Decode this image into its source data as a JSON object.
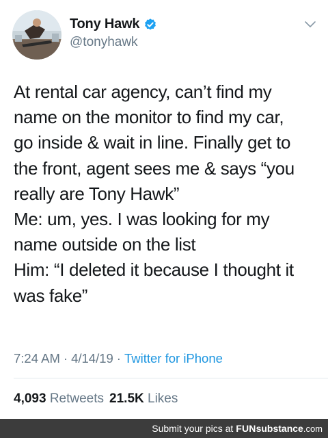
{
  "tweet": {
    "display_name": "Tony Hawk",
    "handle": "@tonyhawk",
    "text_lines": [
      "At rental car agency, can’t find my",
      "name on the monitor to find my car,",
      "go inside & wait in line. Finally get to",
      "the front, agent sees me & says “you",
      "really are Tony Hawk”",
      "Me: um, yes. I was looking for my",
      "name outside on the list",
      "Him: “I deleted it because I thought it",
      "was fake”"
    ],
    "time": "7:24 AM",
    "date": "4/14/19",
    "source": "Twitter for iPhone",
    "retweets_count": "4,093",
    "retweets_label": "Retweets",
    "likes_count": "21.5K",
    "likes_label": "Likes"
  },
  "icons": {
    "avatar": "avatar",
    "verified": "verified-badge-icon",
    "caret": "chevron-down-icon"
  },
  "footer": {
    "prefix": "Submit your pics at",
    "brand_part1": "FUN",
    "brand_part2": "substance",
    "brand_suffix": ".com"
  },
  "colors": {
    "text": "#14171a",
    "secondary": "#657786",
    "link": "#1b95e0",
    "verified": "#1da1f2",
    "footer_bg": "#3c3c3c"
  }
}
